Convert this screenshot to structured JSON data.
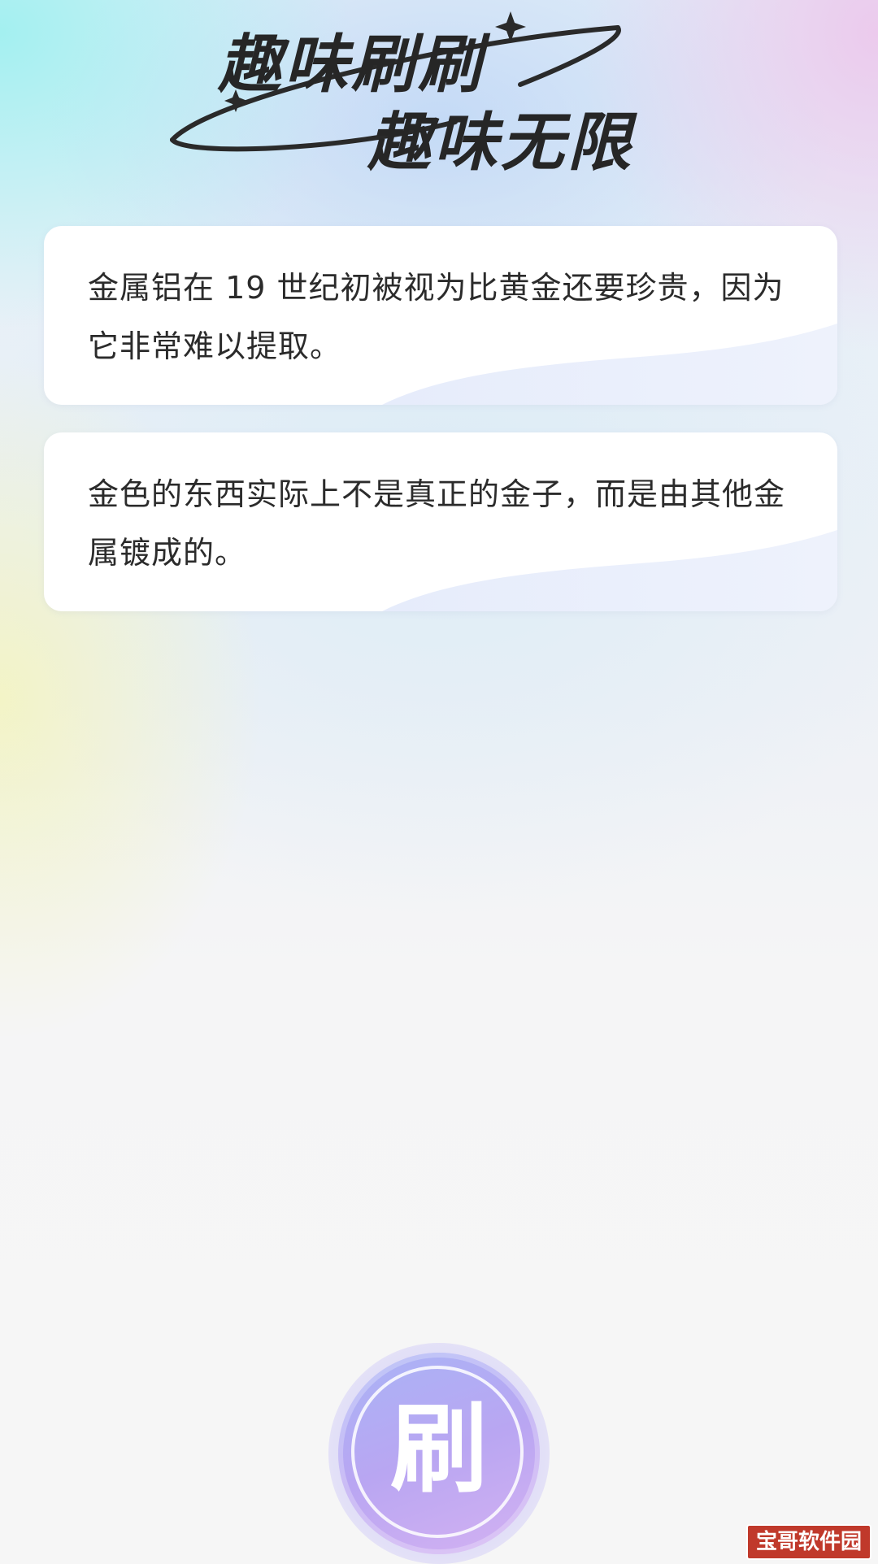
{
  "header": {
    "title_line1": "趣味刷刷",
    "title_line2": "趣味无限"
  },
  "facts": [
    {
      "text": "金属铝在 19 世纪初被视为比黄金还要珍贵，因为它非常难以提取。"
    },
    {
      "text": "金色的东西实际上不是真正的金子，而是由其他金属镀成的。"
    }
  ],
  "refresh_button": {
    "label": "刷"
  },
  "watermark": {
    "text": "宝哥软件园"
  },
  "colors": {
    "title": "#262626",
    "card_text": "#2b2b2b",
    "button_gradient_start": "#a9b4f6",
    "button_gradient_end": "#d4b2f2",
    "watermark_bg": "#c0392b"
  }
}
